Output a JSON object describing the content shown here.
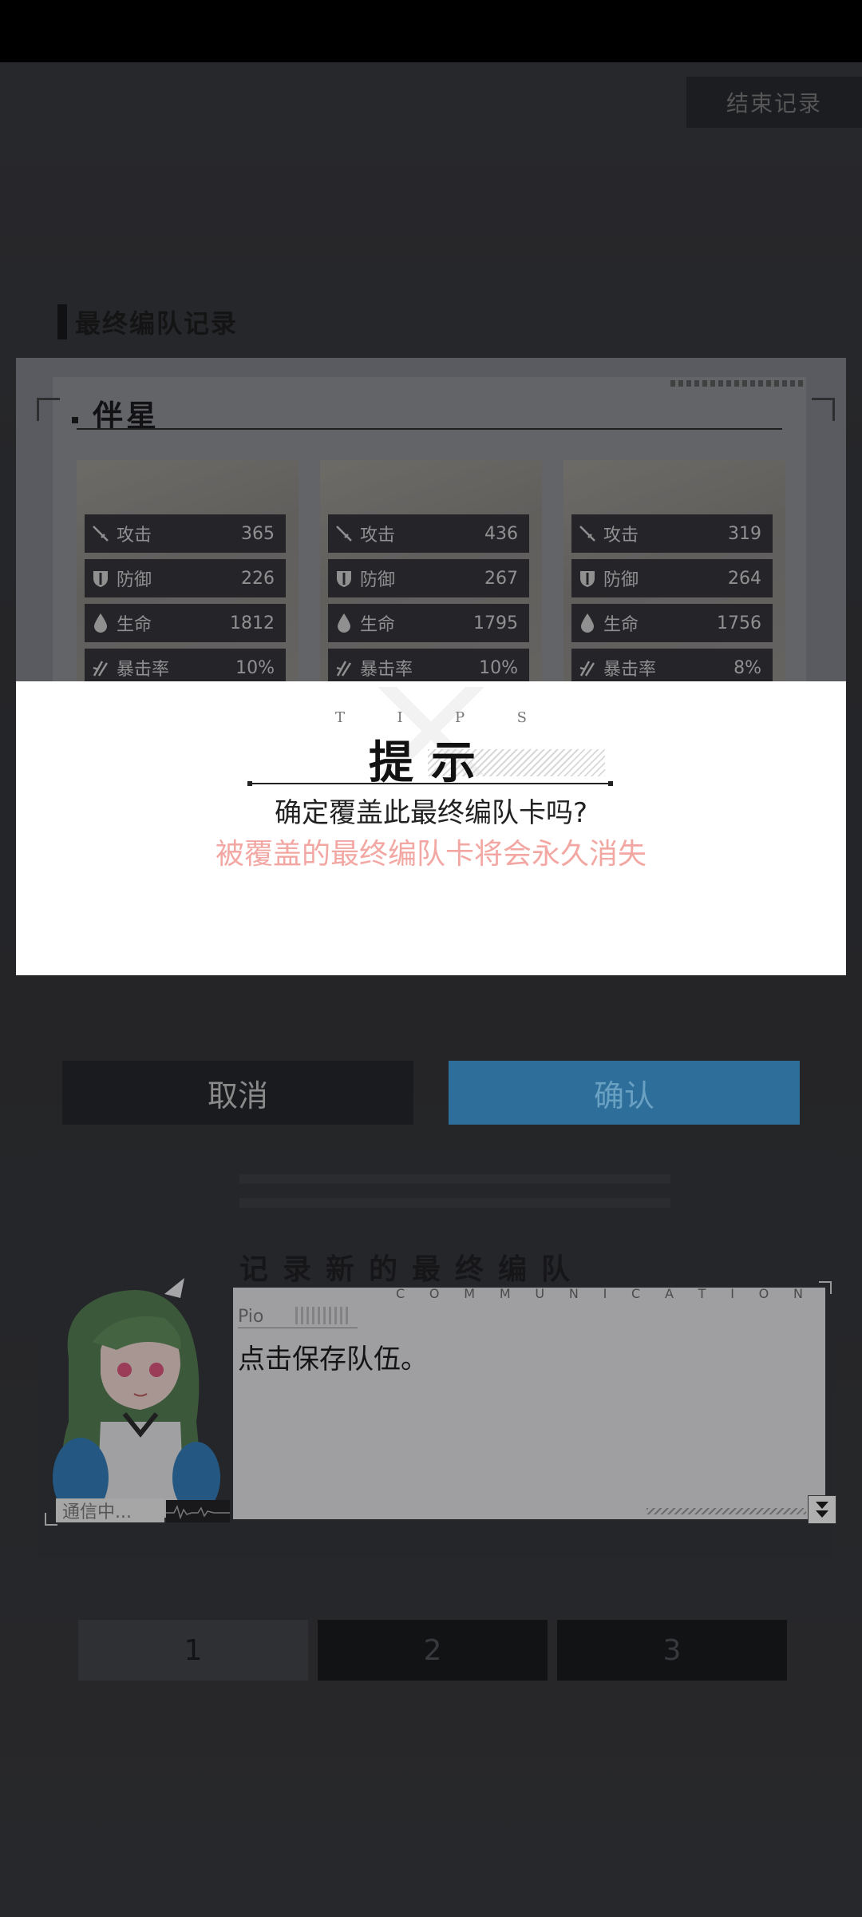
{
  "header": {
    "end_record_label": "结束记录"
  },
  "final_team": {
    "section_title": "最终编队记录",
    "team_name": "伴星",
    "characters": [
      {
        "stats": [
          {
            "icon": "sword-icon",
            "name": "攻击",
            "value": "365"
          },
          {
            "icon": "shield-icon",
            "name": "防御",
            "value": "226"
          },
          {
            "icon": "drop-icon",
            "name": "生命",
            "value": "1812"
          },
          {
            "icon": "crit-icon",
            "name": "暴击率",
            "value": "10%"
          }
        ]
      },
      {
        "stats": [
          {
            "icon": "sword-icon",
            "name": "攻击",
            "value": "436"
          },
          {
            "icon": "shield-icon",
            "name": "防御",
            "value": "267"
          },
          {
            "icon": "drop-icon",
            "name": "生命",
            "value": "1795"
          },
          {
            "icon": "crit-icon",
            "name": "暴击率",
            "value": "10%"
          }
        ]
      },
      {
        "stats": [
          {
            "icon": "sword-icon",
            "name": "攻击",
            "value": "319"
          },
          {
            "icon": "shield-icon",
            "name": "防御",
            "value": "264"
          },
          {
            "icon": "drop-icon",
            "name": "生命",
            "value": "1756"
          },
          {
            "icon": "crit-icon",
            "name": "暴击率",
            "value": "8%"
          }
        ]
      }
    ]
  },
  "dialog": {
    "tips_en": [
      "T",
      "I",
      "P",
      "S"
    ],
    "title": "提示",
    "message": "确定覆盖此最终编队卡吗?",
    "warning": "被覆盖的最终编队卡将会永久消失",
    "cancel_label": "取消",
    "confirm_label": "确认",
    "warning_color": "#f3a7a3",
    "confirm_color": "#2d6e9a"
  },
  "record_new": {
    "title": "记录新的最终编队"
  },
  "communication": {
    "label_letters": [
      "C",
      "O",
      "M",
      "M",
      "U",
      "N",
      "I",
      "C",
      "A",
      "T",
      "I",
      "O",
      "N"
    ],
    "speaker": "Pio",
    "text": "点击保存队伍。",
    "status": "通信中..."
  },
  "slots": [
    "1",
    "2",
    "3"
  ]
}
